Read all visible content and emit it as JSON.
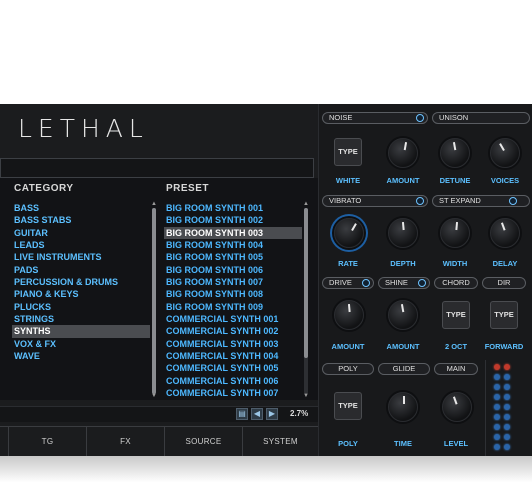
{
  "app": {
    "logo_text": "LETHAL"
  },
  "browser": {
    "category_header": "CATEGORY",
    "preset_header": "PRESET",
    "categories": [
      {
        "label": "BASS",
        "selected": false
      },
      {
        "label": "BASS STABS",
        "selected": false
      },
      {
        "label": "GUITAR",
        "selected": false
      },
      {
        "label": "LEADS",
        "selected": false
      },
      {
        "label": "LIVE INSTRUMENTS",
        "selected": false
      },
      {
        "label": "PADS",
        "selected": false
      },
      {
        "label": "PERCUSSION & DRUMS",
        "selected": false
      },
      {
        "label": "PIANO & KEYS",
        "selected": false
      },
      {
        "label": "PLUCKS",
        "selected": false
      },
      {
        "label": "STRINGS",
        "selected": false
      },
      {
        "label": "SYNTHS",
        "selected": true
      },
      {
        "label": "VOX & FX",
        "selected": false
      },
      {
        "label": "WAVE",
        "selected": false
      }
    ],
    "presets": [
      {
        "label": "BIG ROOM SYNTH 001",
        "selected": false
      },
      {
        "label": "BIG ROOM SYNTH 002",
        "selected": false
      },
      {
        "label": "BIG ROOM SYNTH 003",
        "selected": true
      },
      {
        "label": "BIG ROOM SYNTH 004",
        "selected": false
      },
      {
        "label": "BIG ROOM SYNTH 005",
        "selected": false
      },
      {
        "label": "BIG ROOM SYNTH 006",
        "selected": false
      },
      {
        "label": "BIG ROOM SYNTH 007",
        "selected": false
      },
      {
        "label": "BIG ROOM SYNTH 008",
        "selected": false
      },
      {
        "label": "BIG ROOM SYNTH 009",
        "selected": false
      },
      {
        "label": "COMMERCIAL SYNTH 001",
        "selected": false
      },
      {
        "label": "COMMERCIAL SYNTH 002",
        "selected": false
      },
      {
        "label": "COMMERCIAL SYNTH 003",
        "selected": false
      },
      {
        "label": "COMMERCIAL SYNTH 004",
        "selected": false
      },
      {
        "label": "COMMERCIAL SYNTH 005",
        "selected": false
      },
      {
        "label": "COMMERCIAL SYNTH 006",
        "selected": false
      },
      {
        "label": "COMMERCIAL SYNTH 007",
        "selected": false
      }
    ],
    "zoom_label": "2.7%"
  },
  "tabs": [
    "TG",
    "FX",
    "SOURCE",
    "SYSTEM"
  ],
  "controls": {
    "noise": "NOISE",
    "unison": "UNISON",
    "white": "WHITE",
    "amount": "AMOUNT",
    "detune": "DETUNE",
    "voices": "VOICES",
    "vibrato": "VIBRATO",
    "st_expand": "ST EXPAND",
    "rate": "RATE",
    "depth": "DEPTH",
    "width": "WIDTH",
    "delay": "DELAY",
    "drive": "DRIVE",
    "shine": "SHINE",
    "chord": "CHORD",
    "dir": "DIR",
    "amount2": "AMOUNT",
    "amount3": "AMOUNT",
    "two_oct": "2 OCT",
    "forward": "FORWARD",
    "poly_pill": "POLY",
    "glide": "GLIDE",
    "main": "MAIN",
    "poly": "POLY",
    "time": "TIME",
    "level": "LEVEL",
    "type_label": "TYPE"
  },
  "colors": {
    "accent": "#4db8ff",
    "panel": "#1b1c1e",
    "selected_row": "#4a4c50"
  }
}
